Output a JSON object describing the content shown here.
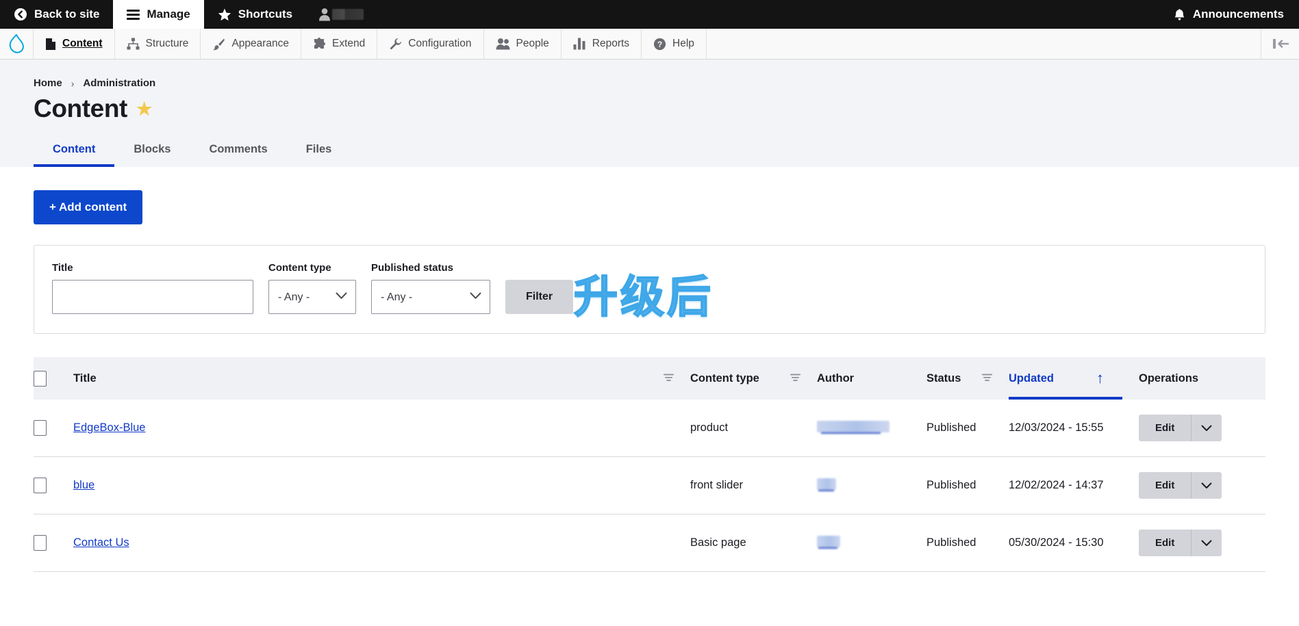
{
  "toolbar": {
    "back_to_site": "Back to site",
    "manage": "Manage",
    "shortcuts": "Shortcuts",
    "announcements": "Announcements",
    "user_name_redacted": ""
  },
  "admin_menu": {
    "items": [
      {
        "label": "Content",
        "icon": "document-icon",
        "active": true
      },
      {
        "label": "Structure",
        "icon": "structure-icon",
        "active": false
      },
      {
        "label": "Appearance",
        "icon": "paintbrush-icon",
        "active": false
      },
      {
        "label": "Extend",
        "icon": "puzzle-icon",
        "active": false
      },
      {
        "label": "Configuration",
        "icon": "wrench-icon",
        "active": false
      },
      {
        "label": "People",
        "icon": "people-icon",
        "active": false
      },
      {
        "label": "Reports",
        "icon": "bar-chart-icon",
        "active": false
      },
      {
        "label": "Help",
        "icon": "question-mark-icon",
        "active": false
      }
    ]
  },
  "breadcrumb": {
    "home": "Home",
    "separator": "›",
    "current": "Administration"
  },
  "page": {
    "title": "Content",
    "star": "★",
    "watermark": "升级后"
  },
  "tabs": [
    {
      "label": "Content",
      "active": true
    },
    {
      "label": "Blocks",
      "active": false
    },
    {
      "label": "Comments",
      "active": false
    },
    {
      "label": "Files",
      "active": false
    }
  ],
  "actions": {
    "add_content": "+ Add content"
  },
  "filters": {
    "title": {
      "label": "Title",
      "value": "",
      "placeholder": ""
    },
    "content_type": {
      "label": "Content type",
      "value": "- Any -",
      "options": [
        "- Any -"
      ]
    },
    "published_status": {
      "label": "Published status",
      "value": "- Any -",
      "options": [
        "- Any -"
      ]
    },
    "filter_button": "Filter"
  },
  "table": {
    "columns": {
      "title": "Title",
      "content_type": "Content type",
      "author": "Author",
      "status": "Status",
      "updated": "Updated",
      "operations": "Operations"
    },
    "sort": {
      "column": "Updated",
      "direction": "ascending",
      "arrow": "↑"
    },
    "rows": [
      {
        "title": "EdgeBox-Blue",
        "content_type": "product",
        "author": "",
        "author_redacted": true,
        "status": "Published",
        "updated": "12/03/2024 - 15:55",
        "operation": "Edit"
      },
      {
        "title": "blue",
        "content_type": "front slider",
        "author": "",
        "author_redacted": true,
        "status": "Published",
        "updated": "12/02/2024 - 14:37",
        "operation": "Edit"
      },
      {
        "title": "Contact Us",
        "content_type": "Basic page",
        "author": "",
        "author_redacted": true,
        "status": "Published",
        "updated": "05/30/2024 - 15:30",
        "operation": "Edit"
      }
    ]
  },
  "colors": {
    "accent_blue": "#113ac7",
    "button_blue": "#0d48cc",
    "toolbar_black": "#141414",
    "star_yellow": "#f2c94c",
    "header_bg": "#f0f1f5"
  }
}
